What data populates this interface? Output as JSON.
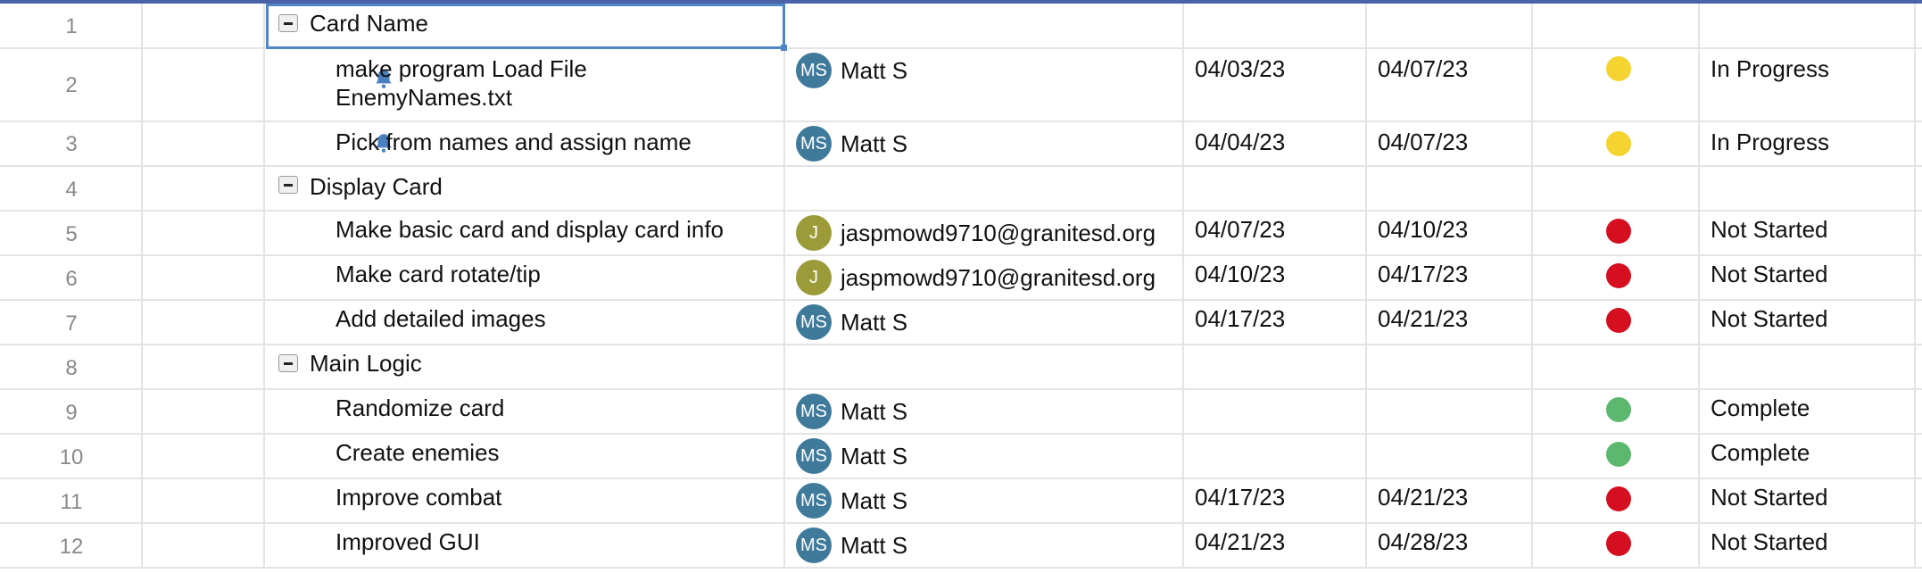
{
  "colors": {
    "yellow": "#f5d330",
    "red": "#d50f1f",
    "green": "#5cb86e",
    "avatar_ms": "#3f7a9b",
    "avatar_j": "#9c9b3a",
    "accent": "#4a63a8"
  },
  "rows": [
    {
      "num": "1",
      "task": "Card Name",
      "type": "parent"
    },
    {
      "num": "2",
      "task_line1": "make program Load File",
      "task_line2": "EnemyNames.txt",
      "bell": "bell-icon",
      "assignee_initials": "MS",
      "assignee": "Matt S",
      "start": "04/03/23",
      "end": "04/07/23",
      "rag": "yellow",
      "status": "In Progress"
    },
    {
      "num": "3",
      "task": "Pick from names and assign name",
      "bell": "bell-icon",
      "assignee_initials": "MS",
      "assignee": "Matt S",
      "start": "04/04/23",
      "end": "04/07/23",
      "rag": "yellow",
      "status": "In Progress"
    },
    {
      "num": "4",
      "task": "Display Card",
      "type": "parent"
    },
    {
      "num": "5",
      "task": "Make basic card and display card info",
      "assignee_initials": "J",
      "assignee": "jaspmowd9710@granitesd.org",
      "start": "04/07/23",
      "end": "04/10/23",
      "rag": "red",
      "status": "Not Started"
    },
    {
      "num": "6",
      "task": "Make card rotate/tip",
      "assignee_initials": "J",
      "assignee": "jaspmowd9710@granitesd.org",
      "start": "04/10/23",
      "end": "04/17/23",
      "rag": "red",
      "status": "Not Started"
    },
    {
      "num": "7",
      "task": "Add detailed images",
      "assignee_initials": "MS",
      "assignee": "Matt S",
      "start": "04/17/23",
      "end": "04/21/23",
      "rag": "red",
      "status": "Not Started"
    },
    {
      "num": "8",
      "task": "Main Logic",
      "type": "parent"
    },
    {
      "num": "9",
      "task": "Randomize card",
      "assignee_initials": "MS",
      "assignee": "Matt S",
      "start": "",
      "end": "",
      "rag": "green",
      "status": "Complete"
    },
    {
      "num": "10",
      "task": "Create enemies",
      "assignee_initials": "MS",
      "assignee": "Matt S",
      "start": "",
      "end": "",
      "rag": "green",
      "status": "Complete"
    },
    {
      "num": "11",
      "task": "Improve combat",
      "assignee_initials": "MS",
      "assignee": "Matt S",
      "start": "04/17/23",
      "end": "04/21/23",
      "rag": "red",
      "status": "Not Started"
    },
    {
      "num": "12",
      "task": "Improved GUI",
      "assignee_initials": "MS",
      "assignee": "Matt S",
      "start": "04/21/23",
      "end": "04/28/23",
      "rag": "red",
      "status": "Not Started"
    }
  ]
}
